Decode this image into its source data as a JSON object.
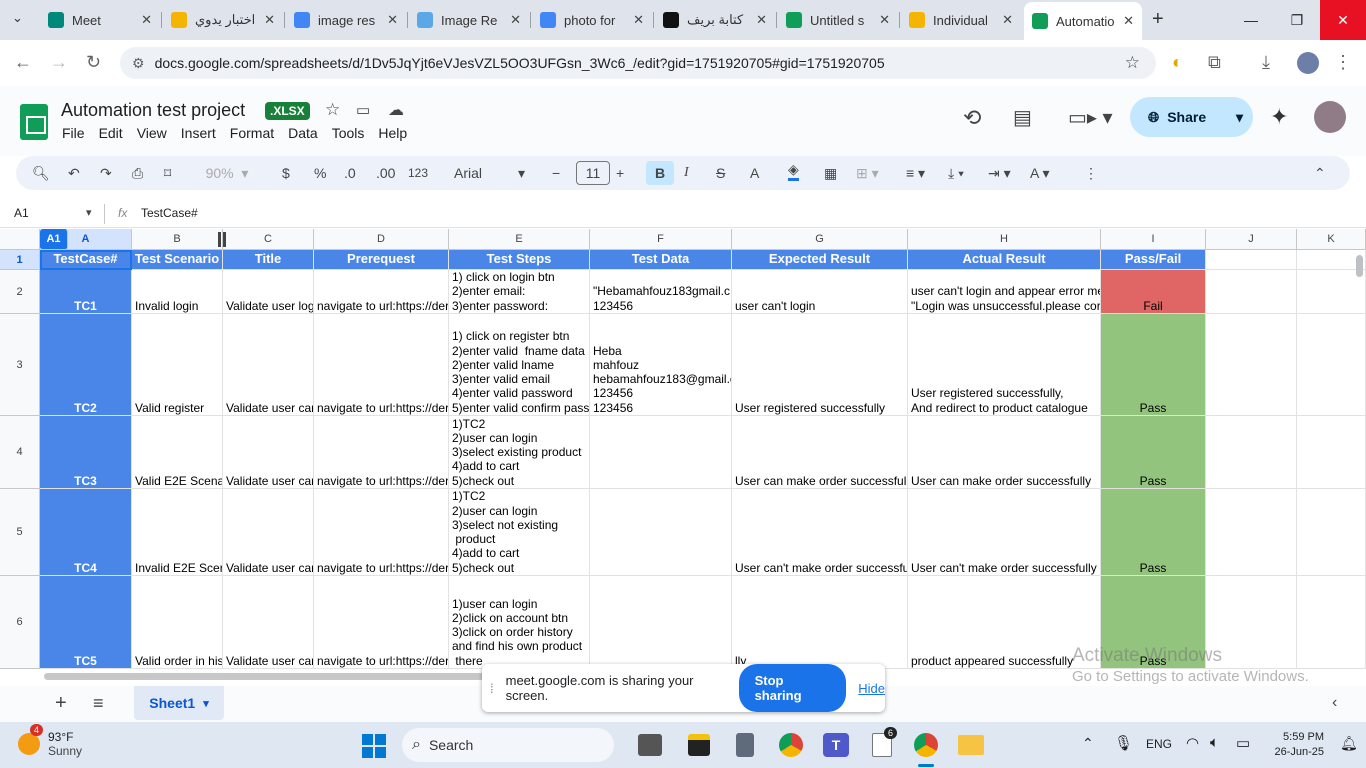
{
  "browser": {
    "tabs": [
      {
        "title": "Meet",
        "icon": "meet-icon",
        "color": "#00897b"
      },
      {
        "title": "اختبار يدوي",
        "icon": "bookmark-icon",
        "color": "#f4b400"
      },
      {
        "title": "image res",
        "icon": "google-icon",
        "color": "#4285f4"
      },
      {
        "title": "Image Re",
        "icon": "image-icon",
        "color": "#5aa9e6"
      },
      {
        "title": "photo for",
        "icon": "google-icon",
        "color": "#4285f4"
      },
      {
        "title": "كتابة بريف",
        "icon": "chatgpt-icon",
        "color": "#111111"
      },
      {
        "title": "Untitled s",
        "icon": "sheets-icon",
        "color": "#0f9d58"
      },
      {
        "title": "Individual",
        "icon": "drive-icon",
        "color": "#f4b400"
      },
      {
        "title": "Automatio",
        "icon": "sheets-icon",
        "color": "#0f9d58"
      }
    ],
    "url": "docs.google.com/spreadsheets/d/1Dv5JqYjt6eVJesVZL5OO3UFGsn_3Wc6_/edit?gid=1751920705#gid=1751920705"
  },
  "doc": {
    "title": "Automation test project",
    "badge": ".XLSX",
    "menu": [
      "File",
      "Edit",
      "View",
      "Insert",
      "Format",
      "Data",
      "Tools",
      "Help"
    ],
    "share_label": "Share"
  },
  "toolbar": {
    "zoom": "90%",
    "currency": "$",
    "percent": "%",
    "dec_dec": ".0",
    "inc_dec": ".00",
    "number_format": "123",
    "font": "Arial",
    "font_size": "11"
  },
  "formula": {
    "name_box": "A1",
    "fx": "fx",
    "content": "TestCase#"
  },
  "grid": {
    "active_col_label": "A1",
    "columns": [
      "A",
      "B",
      "C",
      "D",
      "E",
      "F",
      "G",
      "H",
      "I",
      "J",
      "K"
    ],
    "row_numbers": [
      "1",
      "2",
      "3",
      "4",
      "5",
      "6"
    ],
    "header": [
      "TestCase#",
      "Test Scenario",
      "Title",
      "Prerequest",
      "Test Steps",
      "Test Data",
      "Expected Result",
      "Actual Result",
      "Pass/Fail"
    ],
    "rows": [
      [
        "TC1",
        "Invalid login",
        "Validate user log",
        "navigate to url:https://der",
        "1) click on login btn\n2)enter email:\n3)enter password:",
        "\"Hebamahfouz183gmail.c\n123456",
        "user can't login",
        "user can't login and appear error me\n\"Login was unsuccessful.please cor",
        "Fail"
      ],
      [
        "TC2",
        "Valid register",
        "Validate user car",
        "navigate to url:https://der",
        "1) click on register btn\n2)enter valid  fname data\n2)enter valid lname\n3)enter valid email\n4)enter valid password\n5)enter valid confirm pass",
        "Heba\nmahfouz\nhebamahfouz183@gmail.c\n123456\n123456",
        "User registered successfully",
        "User registered successfully,\nAnd redirect to product catalogue",
        "Pass"
      ],
      [
        "TC3",
        "Valid E2E Scena",
        "Validate user car",
        "navigate to url:https://der",
        "1)TC2\n2)user can login\n3)select existing product\n4)add to cart\n5)check out",
        "",
        "User can make order successfull",
        "User can make order successfully",
        "Pass"
      ],
      [
        "TC4",
        "Invalid E2E Scer",
        "Validate user car",
        "navigate to url:https://der",
        "1)TC2\n2)user can login\n3)select not existing\n product\n4)add to cart\n5)check out",
        "",
        "User can't make order successfu",
        "User can't make order successfully",
        "Pass"
      ],
      [
        "TC5",
        "Valid order in his",
        "Validate user car",
        "navigate to url:https://der",
        "1)user can login\n2)click on account btn\n3)click on order history\nand find his own product\n there",
        "",
        "lly",
        "product appeared successfully",
        "Pass"
      ]
    ],
    "status_colors": {
      "header": "#4a86e8",
      "fail": "#e06666",
      "pass": "#93c47d"
    }
  },
  "sheets": {
    "active": "Sheet1"
  },
  "share_banner": {
    "text": "meet.google.com is sharing your screen.",
    "stop_label": "Stop sharing",
    "hide_label": "Hide"
  },
  "activation": {
    "title": "Activate Windows",
    "subtitle": "Go to Settings to activate Windows."
  },
  "taskbar": {
    "weather_temp": "93°F",
    "weather_desc": "Sunny",
    "weather_badge": "4",
    "search_placeholder": "Search",
    "language": "ENG",
    "time": "5:59 PM",
    "date": "26-Jun-25",
    "files_badge": "6"
  }
}
